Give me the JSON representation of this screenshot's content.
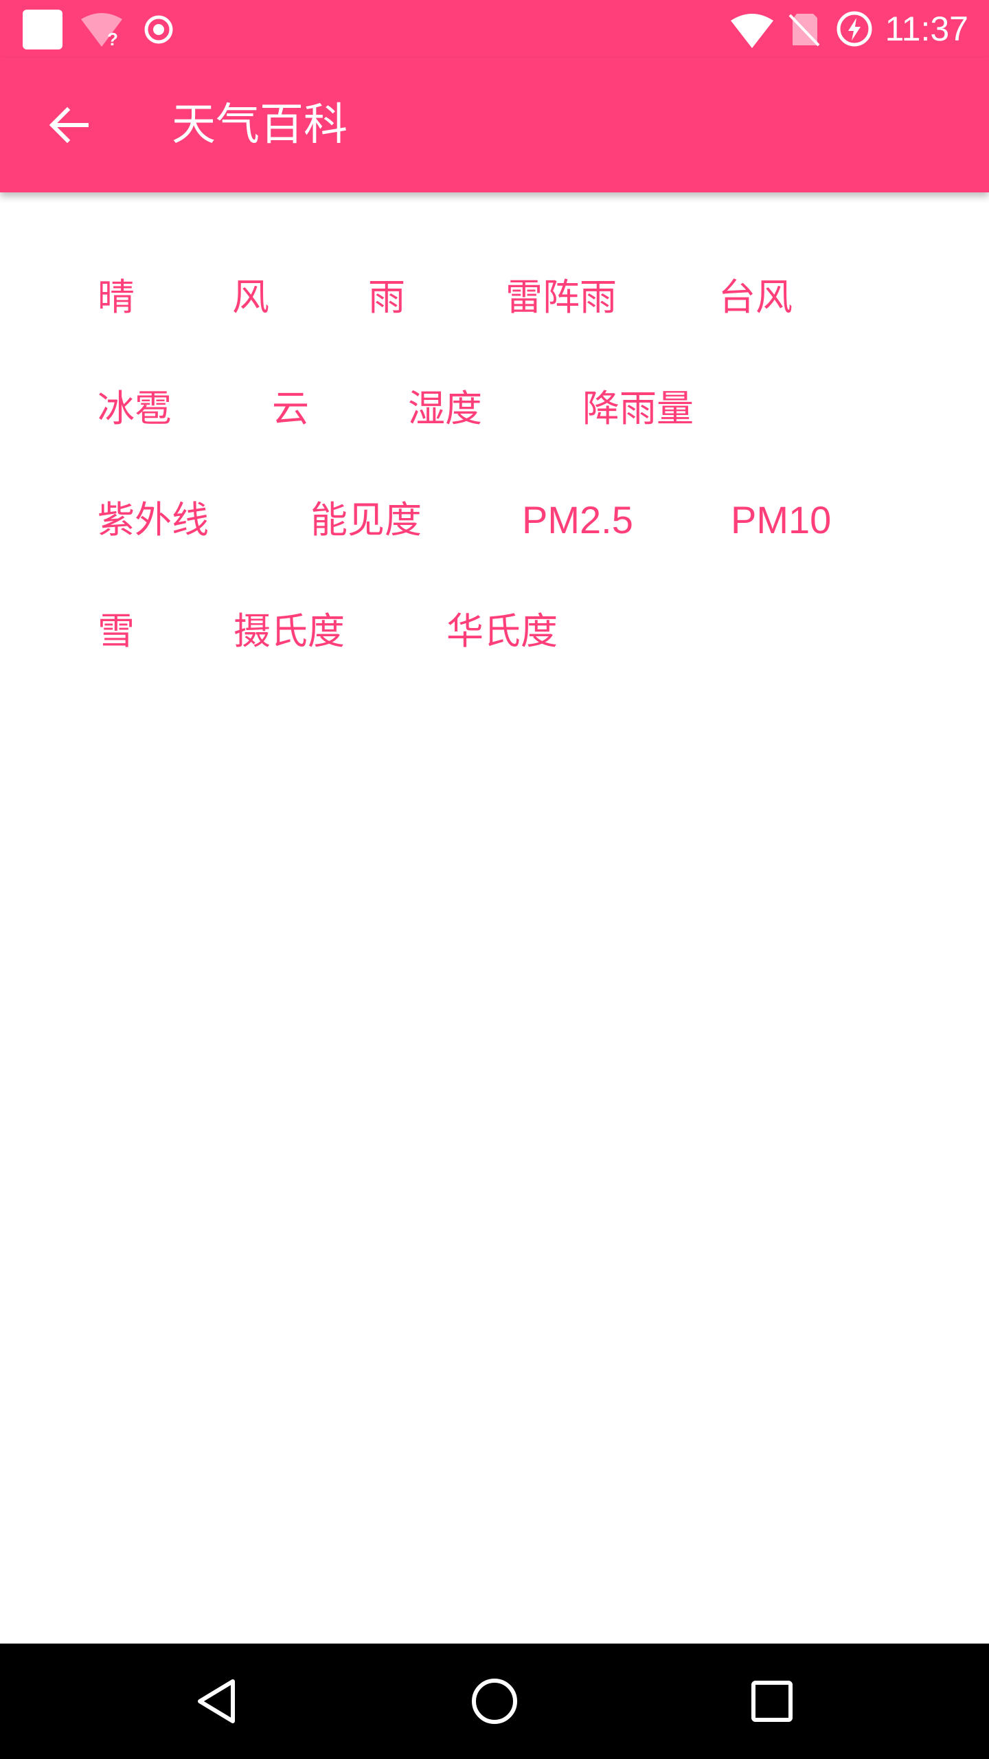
{
  "status_bar": {
    "time": "11:37",
    "icons": [
      "app-notification-icon",
      "wifi-unknown-icon",
      "record-icon",
      "wifi-icon",
      "no-sim-icon",
      "battery-charging-icon"
    ]
  },
  "app_bar": {
    "title": "天气百科",
    "back_icon": "arrow-back-icon"
  },
  "topics": {
    "row1": [
      "晴",
      "风",
      "雨",
      "雷阵雨",
      "台风"
    ],
    "row2": [
      "冰雹",
      "云",
      "湿度",
      "降雨量"
    ],
    "row3": [
      "紫外线",
      "能见度",
      "PM2.5",
      "PM10"
    ],
    "row4": [
      "雪",
      "摄氏度",
      "华氏度"
    ]
  },
  "nav_bar": {
    "icons": [
      "back-triangle-icon",
      "home-circle-icon",
      "recents-square-icon"
    ]
  },
  "colors": {
    "primary": "#ff3f7a",
    "text_on_primary": "#ffffff",
    "background": "#ffffff",
    "nav_bar": "#000000"
  }
}
